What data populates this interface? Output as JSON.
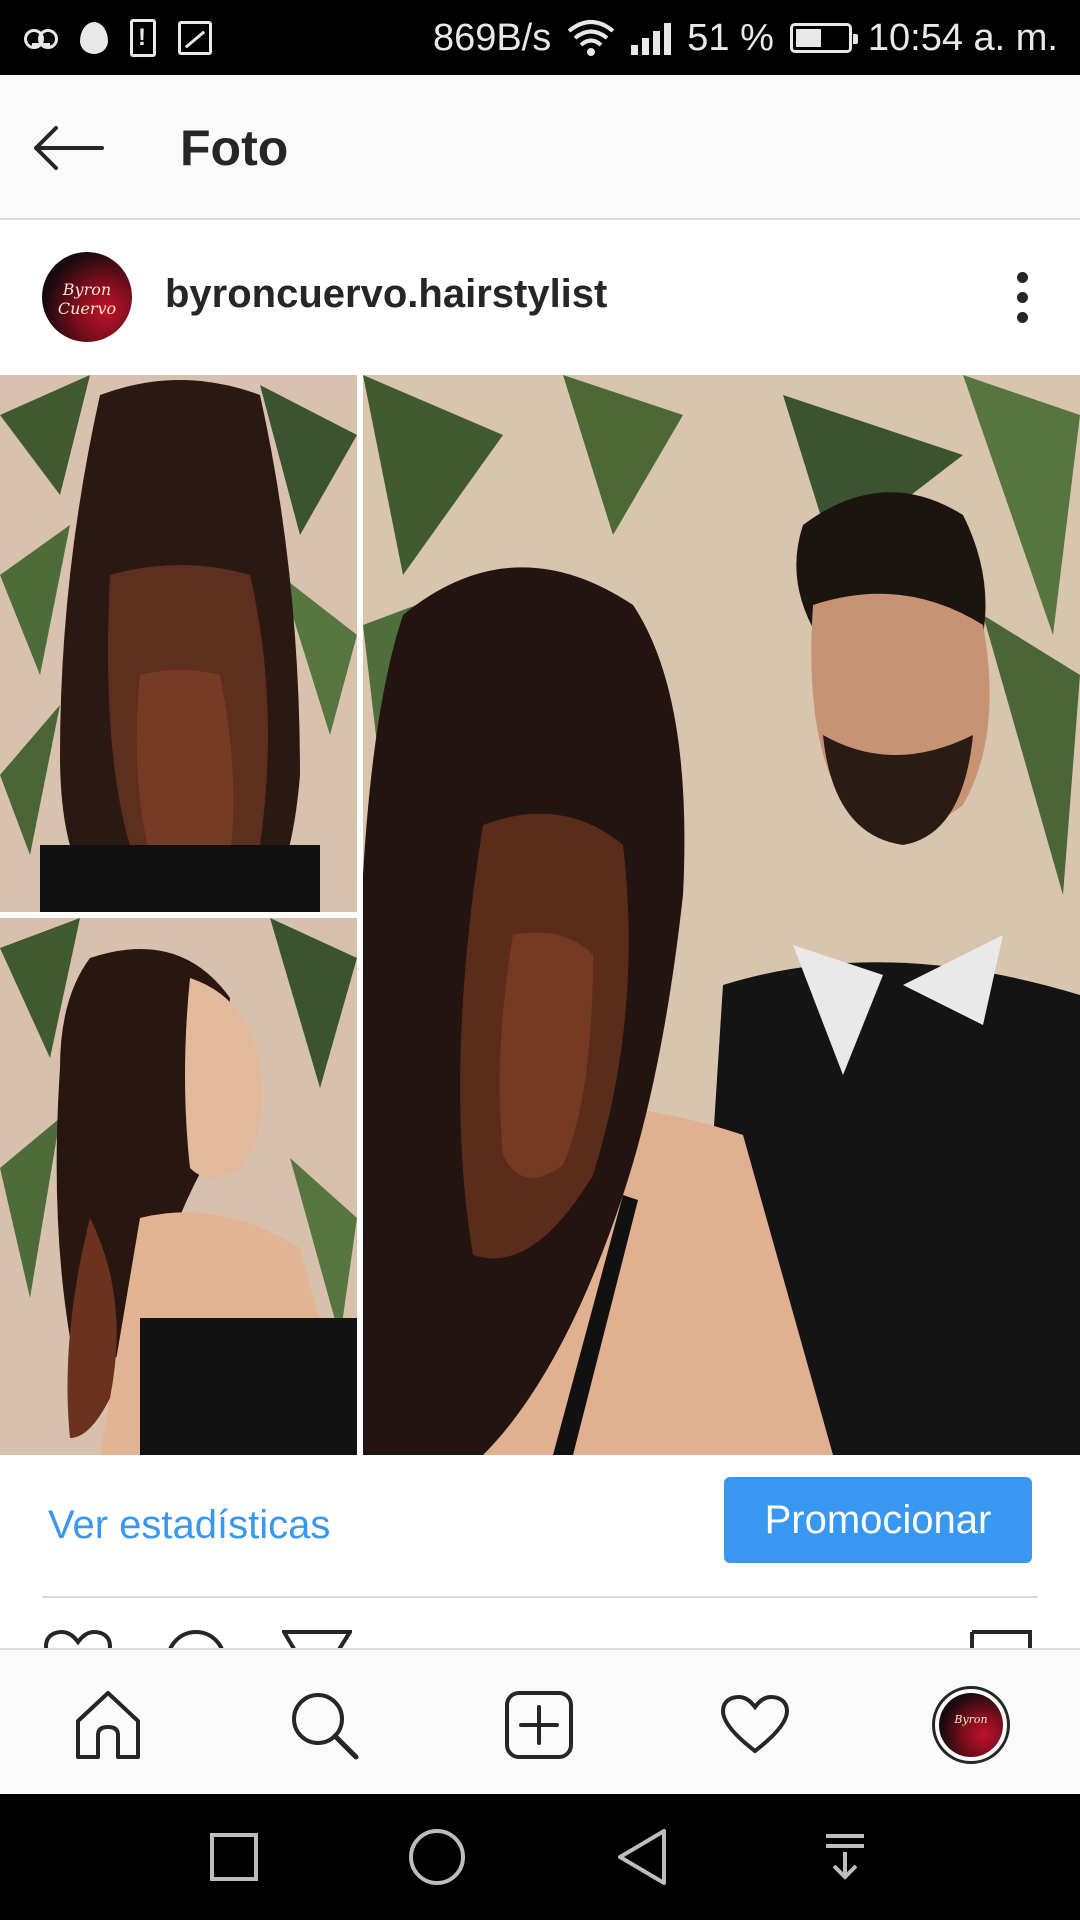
{
  "status_bar": {
    "network_speed": "869B/s",
    "battery_percent": "51 %",
    "battery_level": 0.51,
    "time": "10:54 a. m.",
    "icons": [
      "voicemail-icon",
      "data-saver-icon",
      "battery-alert-icon",
      "image-icon",
      "wifi-icon",
      "cell-signal-icon",
      "battery-icon"
    ]
  },
  "app_bar": {
    "title": "Foto",
    "back_icon": "arrow-left-icon"
  },
  "post": {
    "username": "byroncuervo.hairstylist",
    "avatar_icon": "profile-avatar",
    "more_icon": "more-vertical-icon",
    "photo": {
      "panels": [
        "hair-back-view",
        "woman-side-profile",
        "couple-portrait"
      ]
    },
    "actions": {
      "insights_label": "Ver estadísticas",
      "promote_label": "Promocionar",
      "row_icons": [
        "heart-icon",
        "comment-icon",
        "share-icon",
        "bookmark-icon"
      ]
    }
  },
  "bottom_nav": {
    "items": [
      {
        "name": "home",
        "icon": "home-icon"
      },
      {
        "name": "search",
        "icon": "search-icon"
      },
      {
        "name": "new-post",
        "icon": "plus-square-icon"
      },
      {
        "name": "activity",
        "icon": "heart-icon"
      },
      {
        "name": "profile",
        "icon": "profile-avatar"
      }
    ]
  },
  "system_nav": {
    "buttons": [
      "recents-square-icon",
      "home-circle-icon",
      "back-triangle-icon",
      "notifications-pulldown-icon"
    ]
  },
  "colors": {
    "accent_blue": "#3897f0",
    "text_primary": "#262626",
    "divider": "#dbdbdb",
    "bar_background": "#fafafa",
    "system_bar": "#000000"
  }
}
